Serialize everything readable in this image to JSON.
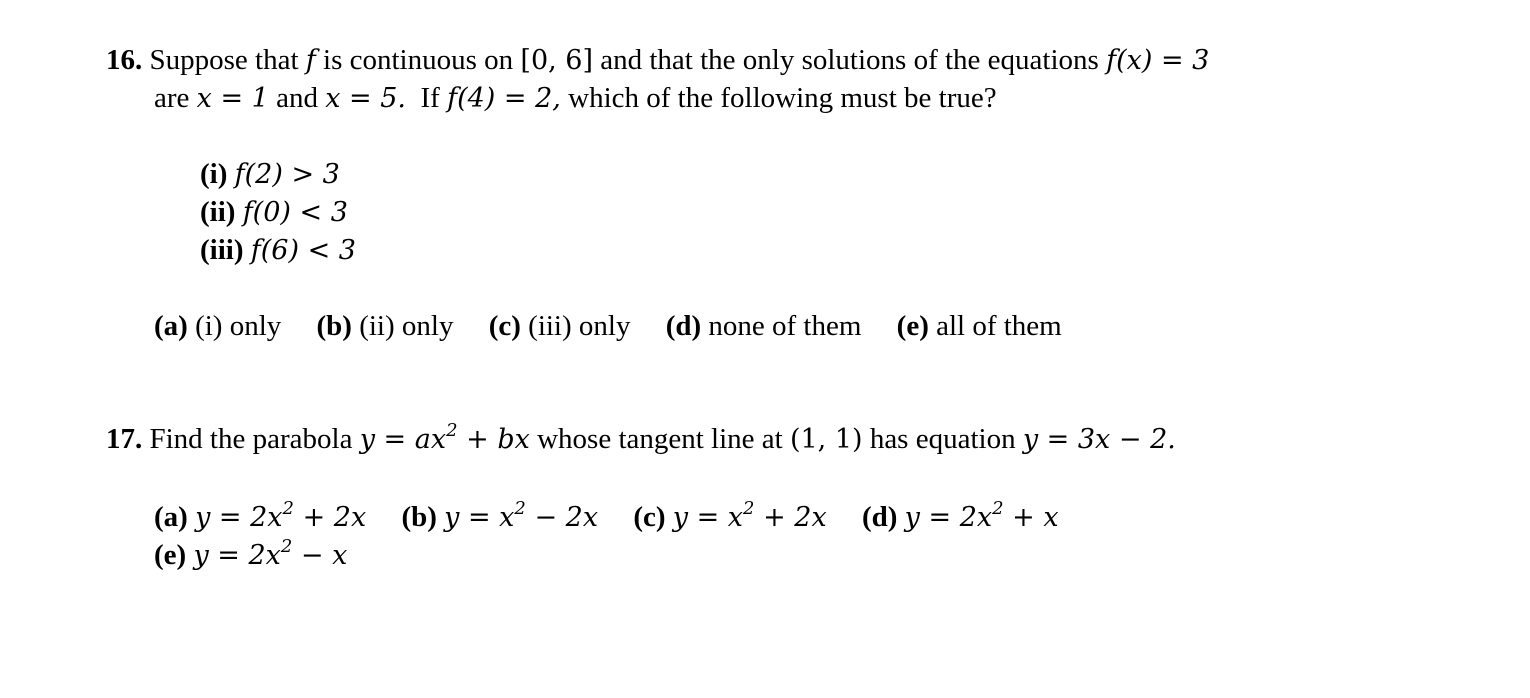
{
  "problems": [
    {
      "number": "16.",
      "line1": {
        "t1": "Suppose that",
        "m1": "f",
        "t2": "is continuous on",
        "m2": "[0, 6]",
        "t3": "and that the only solutions of the equations",
        "m3": "f(x) = 3"
      },
      "line2": {
        "t1": "are",
        "m1": "x = 1",
        "t2": "and",
        "m2": "x = 5.",
        "t3": "If",
        "m3": "f(4) = 2,",
        "t4": "which of the following must be true?"
      },
      "statements": [
        {
          "label": "(i)",
          "expr": "f(2) > 3"
        },
        {
          "label": "(ii)",
          "expr": "f(0) < 3"
        },
        {
          "label": "(iii)",
          "expr": "f(6) < 3"
        }
      ],
      "choices": [
        {
          "label": "(a)",
          "text": "(i) only"
        },
        {
          "label": "(b)",
          "text": "(ii) only"
        },
        {
          "label": "(c)",
          "text": "(iii) only"
        },
        {
          "label": "(d)",
          "text": "none of them"
        },
        {
          "label": "(e)",
          "text": "all of them"
        }
      ]
    },
    {
      "number": "17.",
      "line1": {
        "t1": "Find the parabola",
        "m1_a": "y = ax",
        "m1_sup": "2",
        "m1_b": " + bx",
        "t2": "whose tangent line at",
        "m2": "(1, 1)",
        "t3": "has equation",
        "m3": "y = 3x − 2."
      },
      "choices": [
        {
          "label": "(a)",
          "pre": "y = 2x",
          "sup": "2",
          "post": " + 2x"
        },
        {
          "label": "(b)",
          "pre": "y = x",
          "sup": "2",
          "post": " − 2x"
        },
        {
          "label": "(c)",
          "pre": "y = x",
          "sup": "2",
          "post": " + 2x"
        },
        {
          "label": "(d)",
          "pre": "y = 2x",
          "sup": "2",
          "post": " + x"
        },
        {
          "label": "(e)",
          "pre": "y = 2x",
          "sup": "2",
          "post": " − x"
        }
      ]
    }
  ]
}
